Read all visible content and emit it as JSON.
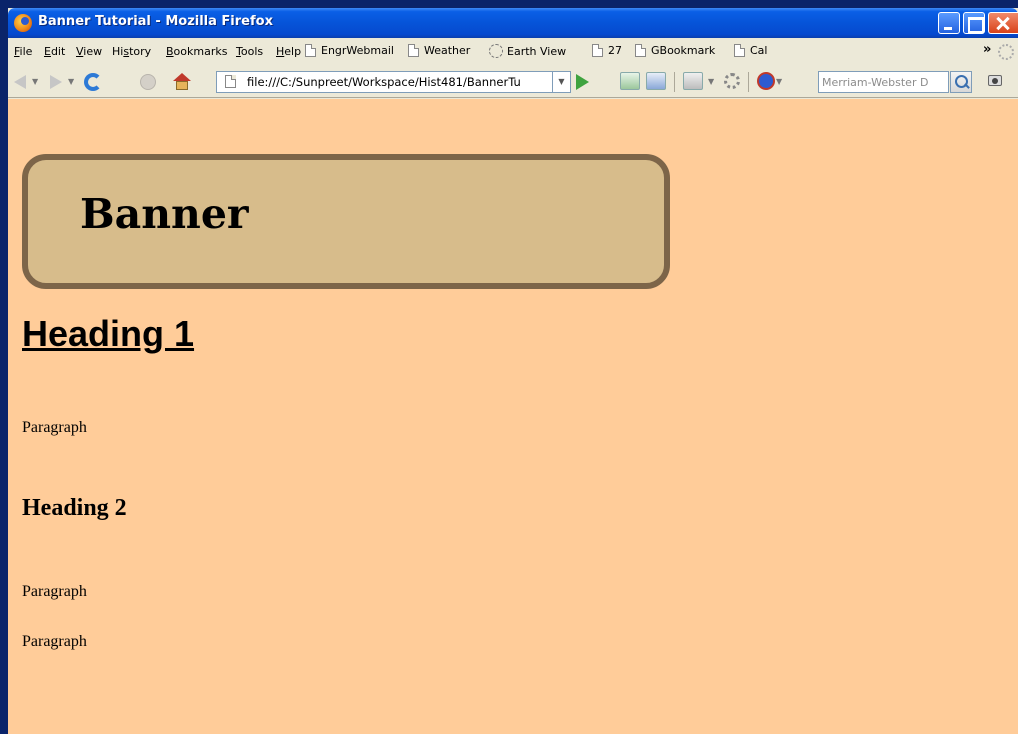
{
  "window": {
    "title": "Banner Tutorial - Mozilla Firefox"
  },
  "menubar": {
    "items": [
      "File",
      "Edit",
      "View",
      "History",
      "Bookmarks",
      "Tools",
      "Help"
    ],
    "underlined": [
      "F",
      "E",
      "V",
      "s",
      "B",
      "T",
      "H"
    ]
  },
  "bookmarks": {
    "items": [
      "EngrWebmail",
      "Weather",
      "Earth View",
      "27",
      "GBookmark",
      "Cal"
    ],
    "overflow_label": "»"
  },
  "navbar": {
    "url": "file:///C:/Sunpreet/Workspace/Hist481/BannerTu",
    "search_placeholder": "Merriam-Webster D"
  },
  "page": {
    "background": "#ffcc99",
    "banner": {
      "text": "Banner",
      "fill": "#d7bc8b",
      "border": "#7d6549"
    },
    "heading1": "Heading 1",
    "paragraph1": "Paragraph",
    "heading2": "Heading 2",
    "paragraph2": "Paragraph",
    "paragraph3": "Paragraph"
  },
  "icons": {
    "app": "firefox-icon",
    "back": "back-arrow-icon",
    "forward": "forward-arrow-icon",
    "reload": "reload-icon",
    "stop": "stop-icon",
    "home": "home-icon",
    "go": "go-arrow-icon",
    "search": "magnifier-icon",
    "screenshot": "camera-icon"
  }
}
